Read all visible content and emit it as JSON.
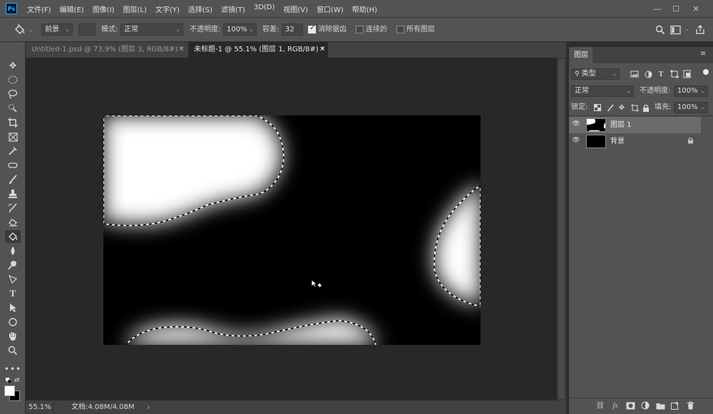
{
  "app": {
    "logo": "Ps"
  },
  "menu": [
    "文件(F)",
    "编辑(E)",
    "图像(I)",
    "图层(L)",
    "文字(Y)",
    "选择(S)",
    "滤镜(T)",
    "3D(D)",
    "视图(V)",
    "窗口(W)",
    "帮助(H)"
  ],
  "window_controls": {
    "minimize": "—",
    "maximize": "☐",
    "close": "✕"
  },
  "options": {
    "tool_icon": "paint-bucket-icon",
    "fill_source": "前景",
    "mode_label": "模式:",
    "mode_value": "正常",
    "opacity_label": "不透明度:",
    "opacity_value": "100%",
    "tolerance_label": "容差:",
    "tolerance_value": "32",
    "antialias_label": "消除锯齿",
    "antialias_checked": true,
    "contiguous_label": "连续的",
    "contiguous_checked": false,
    "all_layers_label": "所有图层",
    "all_layers_checked": false
  },
  "tabs": [
    {
      "label": "Untitled-1.psd @ 73.9% (图层 3, RGB/8#) *",
      "active": false
    },
    {
      "label": "未标题-1 @ 55.1% (图层 1, RGB/8#) *",
      "active": true
    }
  ],
  "status": {
    "zoom": "55.1%",
    "doc_info": "文档:4.08M/4.08M",
    "arrow": "›"
  },
  "layers_panel": {
    "tab_label": "图层",
    "filter_label": "类型",
    "blend_mode": "正常",
    "opacity_label": "不透明度:",
    "opacity_value": "100%",
    "lock_label": "锁定:",
    "fill_label": "填充:",
    "fill_value": "100%",
    "layers": [
      {
        "name": "图层 1",
        "selected": true,
        "locked": false
      },
      {
        "name": "背景",
        "selected": false,
        "locked": true
      }
    ]
  },
  "colors": {
    "ui_bg": "#535353",
    "workspace": "#282828",
    "canvas": "#000000",
    "selection": "#ffffff",
    "accent": "#31a8ff"
  }
}
